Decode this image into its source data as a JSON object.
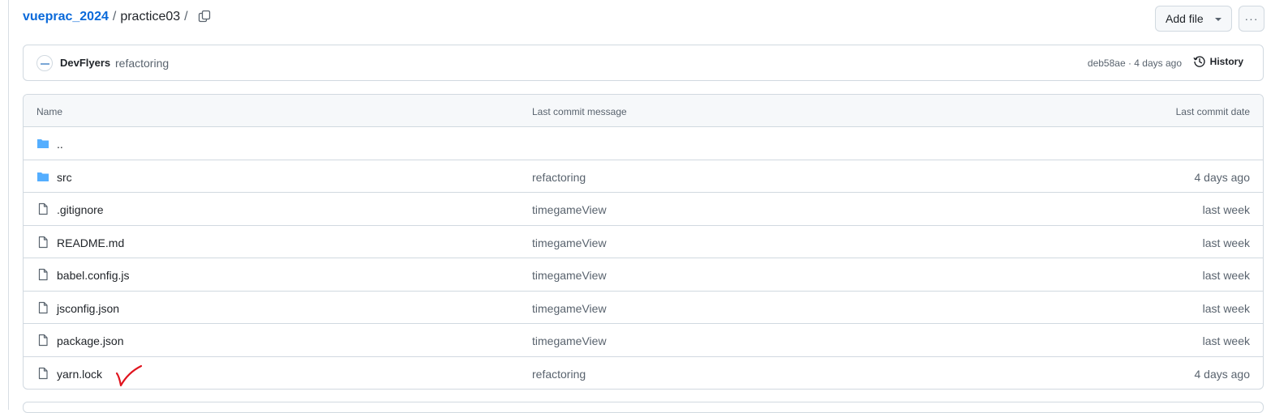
{
  "breadcrumb": {
    "repo": "vueprac_2024",
    "separator": "/",
    "dir": "practice03",
    "trailing_separator": "/"
  },
  "actions": {
    "add_file_label": "Add file",
    "more_label": "···"
  },
  "latest_commit": {
    "author": "DevFlyers",
    "message": "refactoring",
    "meta": "deb58ae · 4 days ago",
    "history_label": "History"
  },
  "table": {
    "headers": {
      "name": "Name",
      "message": "Last commit message",
      "date": "Last commit date"
    },
    "rows": [
      {
        "type": "folder",
        "name": "..",
        "message": "",
        "date": ""
      },
      {
        "type": "folder",
        "name": "src",
        "message": "refactoring",
        "date": "4 days ago"
      },
      {
        "type": "file",
        "name": ".gitignore",
        "message": "timegameView",
        "date": "last week"
      },
      {
        "type": "file",
        "name": "README.md",
        "message": "timegameView",
        "date": "last week"
      },
      {
        "type": "file",
        "name": "babel.config.js",
        "message": "timegameView",
        "date": "last week"
      },
      {
        "type": "file",
        "name": "jsconfig.json",
        "message": "timegameView",
        "date": "last week"
      },
      {
        "type": "file",
        "name": "package.json",
        "message": "timegameView",
        "date": "last week"
      },
      {
        "type": "file",
        "name": "yarn.lock",
        "message": "refactoring",
        "date": "4 days ago"
      }
    ]
  },
  "icons": {
    "folder": "folder-icon",
    "file": "file-icon",
    "copy": "copy-icon",
    "history": "history-icon",
    "annotation": "red-checkmark-icon"
  },
  "colors": {
    "link": "#0969da",
    "folder": "#54aeff",
    "annotation": "#e0141e"
  }
}
